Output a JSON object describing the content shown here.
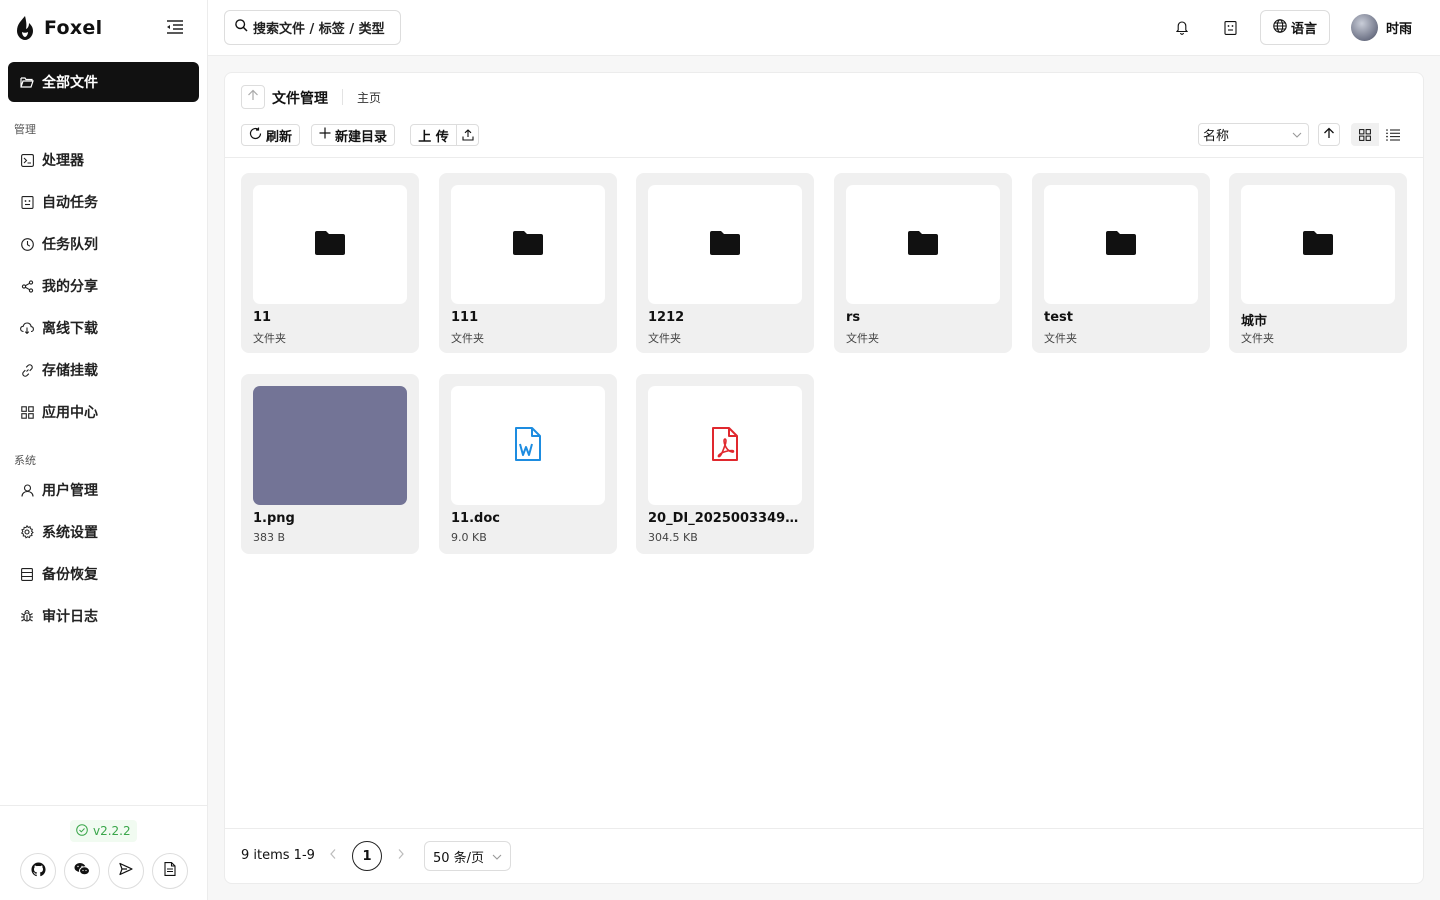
{
  "app": {
    "name": "Foxel",
    "version": "v2.2.2"
  },
  "sidebar": {
    "active": {
      "label": "全部文件",
      "icon": "folder-open-icon"
    },
    "sections": [
      {
        "label": "管理",
        "items": [
          {
            "label": "处理器",
            "icon": "terminal-icon"
          },
          {
            "label": "自动任务",
            "icon": "robot-icon"
          },
          {
            "label": "任务队列",
            "icon": "clock-icon"
          },
          {
            "label": "我的分享",
            "icon": "share-icon"
          },
          {
            "label": "离线下载",
            "icon": "cloud-download-icon"
          },
          {
            "label": "存储挂载",
            "icon": "link-icon"
          },
          {
            "label": "应用中心",
            "icon": "apps-icon"
          }
        ]
      },
      {
        "label": "系统",
        "items": [
          {
            "label": "用户管理",
            "icon": "user-icon"
          },
          {
            "label": "系统设置",
            "icon": "gear-icon"
          },
          {
            "label": "备份恢复",
            "icon": "database-icon"
          },
          {
            "label": "审计日志",
            "icon": "bug-icon"
          }
        ]
      }
    ],
    "bottom_buttons": [
      "github-icon",
      "wechat-icon",
      "send-icon",
      "document-icon"
    ]
  },
  "header": {
    "search_placeholder": "搜索文件 / 标签 / 类型",
    "language_label": "语言",
    "user_name": "时雨"
  },
  "panel": {
    "title": "文件管理",
    "breadcrumb": "主页",
    "toolbar": {
      "refresh": "刷新",
      "new_folder": "新建目录",
      "upload": "上 传"
    },
    "sort": {
      "selected": "名称"
    },
    "view_mode": "grid",
    "files": [
      {
        "name": "11",
        "meta": "文件夹",
        "type": "folder"
      },
      {
        "name": "111",
        "meta": "文件夹",
        "type": "folder"
      },
      {
        "name": "1212",
        "meta": "文件夹",
        "type": "folder"
      },
      {
        "name": "rs",
        "meta": "文件夹",
        "type": "folder"
      },
      {
        "name": "test",
        "meta": "文件夹",
        "type": "folder"
      },
      {
        "name": "城市",
        "meta": "文件夹",
        "type": "folder"
      },
      {
        "name": "1.png",
        "meta": "383 B",
        "type": "image",
        "color": "#737496"
      },
      {
        "name": "11.doc",
        "meta": "9.0 KB",
        "type": "word",
        "color": "#1d8ce0"
      },
      {
        "name": "20_DI_2025003349_...",
        "meta": "304.5 KB",
        "type": "pdf",
        "color": "#e0282e"
      }
    ],
    "pagination": {
      "total": "9 items 1-9",
      "current": "1",
      "page_size": "50 条/页"
    }
  }
}
